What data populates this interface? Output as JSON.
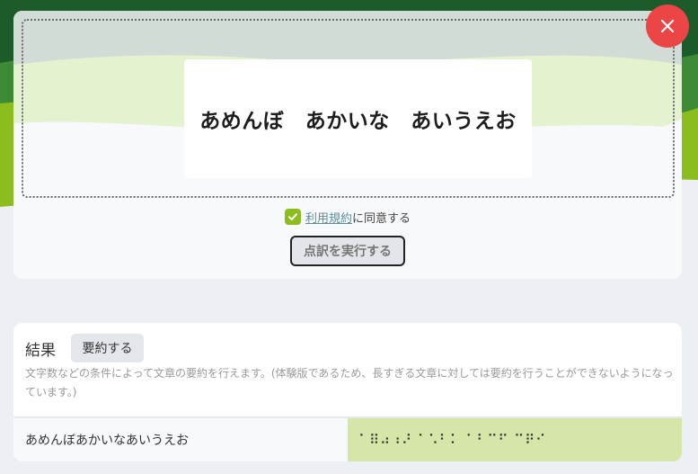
{
  "preview": {
    "text": "あめんぼ　あかいな　あいうえお"
  },
  "close_button": {
    "icon": "close-icon"
  },
  "agreement": {
    "checked": true,
    "link_label": "利用規約",
    "suffix_label": "に同意する"
  },
  "execute_button": {
    "label": "点訳を実行する"
  },
  "result": {
    "title": "結果",
    "summarize_label": "要約する",
    "description": "文字数などの条件によって文章の要約を行えます。(体験版であるため、長すぎる文章に対しては要約を行うことができないようになっています。)",
    "output_text": "あめんぼあかいなあいうえお",
    "output_braille": "⠁⠿⠴⠰⠜ ⠁⠡⠃⠅ ⠁⠃⠉⠋ ⠉⠟⠊"
  },
  "colors": {
    "accent_green": "#8cbd1e",
    "close_red": "#ec4545",
    "braille_bg": "#d5e6a8",
    "dark_green": "#1e5b2a"
  }
}
